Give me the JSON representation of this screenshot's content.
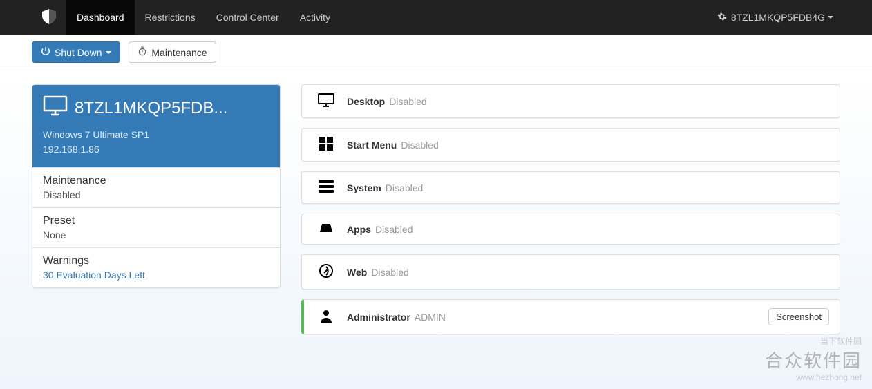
{
  "nav": {
    "items": [
      "Dashboard",
      "Restrictions",
      "Control Center",
      "Activity"
    ],
    "active_index": 0,
    "right_label": "8TZL1MKQP5FDB4G"
  },
  "actions": {
    "shutdown_label": "Shut Down",
    "maintenance_label": "Maintenance"
  },
  "host_card": {
    "title": "8TZL1MKQP5FDB...",
    "os": "Windows 7 Ultimate SP1",
    "ip": "192.168.1.86",
    "items": [
      {
        "label": "Maintenance",
        "value": "Disabled",
        "link": false
      },
      {
        "label": "Preset",
        "value": "None",
        "link": false
      },
      {
        "label": "Warnings",
        "value": "30 Evaluation Days Left",
        "link": true
      }
    ]
  },
  "categories": [
    {
      "icon": "desktop-icon",
      "label": "Desktop",
      "status": "Disabled"
    },
    {
      "icon": "start-menu-icon",
      "label": "Start Menu",
      "status": "Disabled"
    },
    {
      "icon": "system-icon",
      "label": "System",
      "status": "Disabled"
    },
    {
      "icon": "apps-icon",
      "label": "Apps",
      "status": "Disabled"
    },
    {
      "icon": "web-icon",
      "label": "Web",
      "status": "Disabled"
    }
  ],
  "user_row": {
    "icon": "user-icon",
    "label": "Administrator",
    "role": "ADMIN",
    "button": "Screenshot"
  },
  "watermark": {
    "line1": "当下软件园",
    "line2": "合众软件园",
    "line3": "www.hezhong.net"
  }
}
